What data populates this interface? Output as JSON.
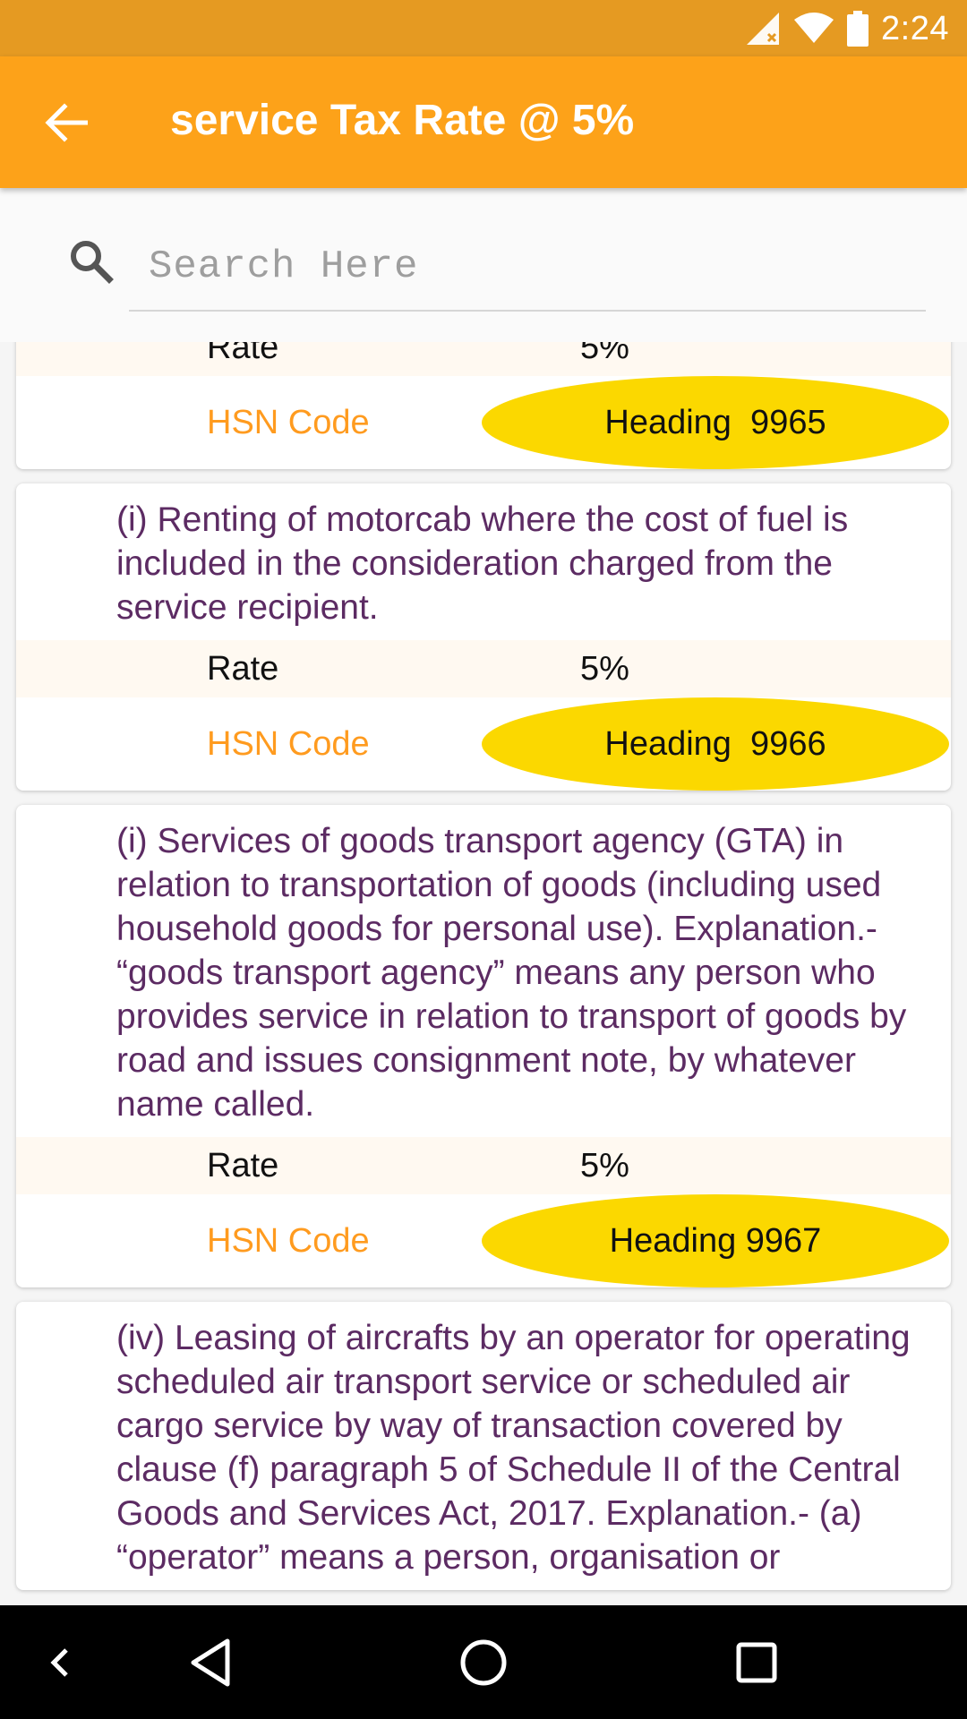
{
  "status_bar": {
    "time": "2:24",
    "icons": [
      "signal-no-data-icon",
      "wifi-icon",
      "battery-icon"
    ]
  },
  "app_bar": {
    "title": "service Tax Rate @ 5%",
    "back_icon": "arrow-back-icon"
  },
  "search": {
    "placeholder": "Search Here",
    "value": ""
  },
  "cards": [
    {
      "description": "",
      "rate_label": "Rate",
      "rate_value": "5%",
      "hsn_label": "HSN Code",
      "hsn_value": "Heading  9965"
    },
    {
      "description": "(i) Renting of motorcab where the cost of fuel is included in the consideration charged from the service recipient.",
      "rate_label": "Rate",
      "rate_value": "5%",
      "hsn_label": "HSN Code",
      "hsn_value": "Heading  9966"
    },
    {
      "description": "(i) Services of goods transport agency (GTA) in relation to transportation of goods (including used household goods for personal use). Explanation.- “goods transport agency” means any person who provides service in relation to transport of goods by road and issues consignment note, by whatever name called.",
      "rate_label": "Rate",
      "rate_value": "5%",
      "hsn_label": "HSN Code",
      "hsn_value": "Heading 9967"
    },
    {
      "description": "(iv) Leasing of aircrafts by an operator for operating scheduled air transport service or scheduled air cargo service by way of transaction covered by clause (f) paragraph 5 of Schedule II of the Central Goods and Services Act, 2017. Explanation.- (a) “operator” means a person, organisation or",
      "rate_label": "",
      "rate_value": "",
      "hsn_label": "",
      "hsn_value": ""
    }
  ],
  "colors": {
    "status_bar": "#e59a22",
    "app_bar": "#fda219",
    "description_text": "#5c2b63",
    "hsn_label": "#ff9b1f",
    "hsn_pill": "#fbd800"
  },
  "nav_bar": {
    "icons": [
      "chevron-left-icon",
      "back-triangle-icon",
      "home-circle-icon",
      "recents-square-icon"
    ]
  }
}
